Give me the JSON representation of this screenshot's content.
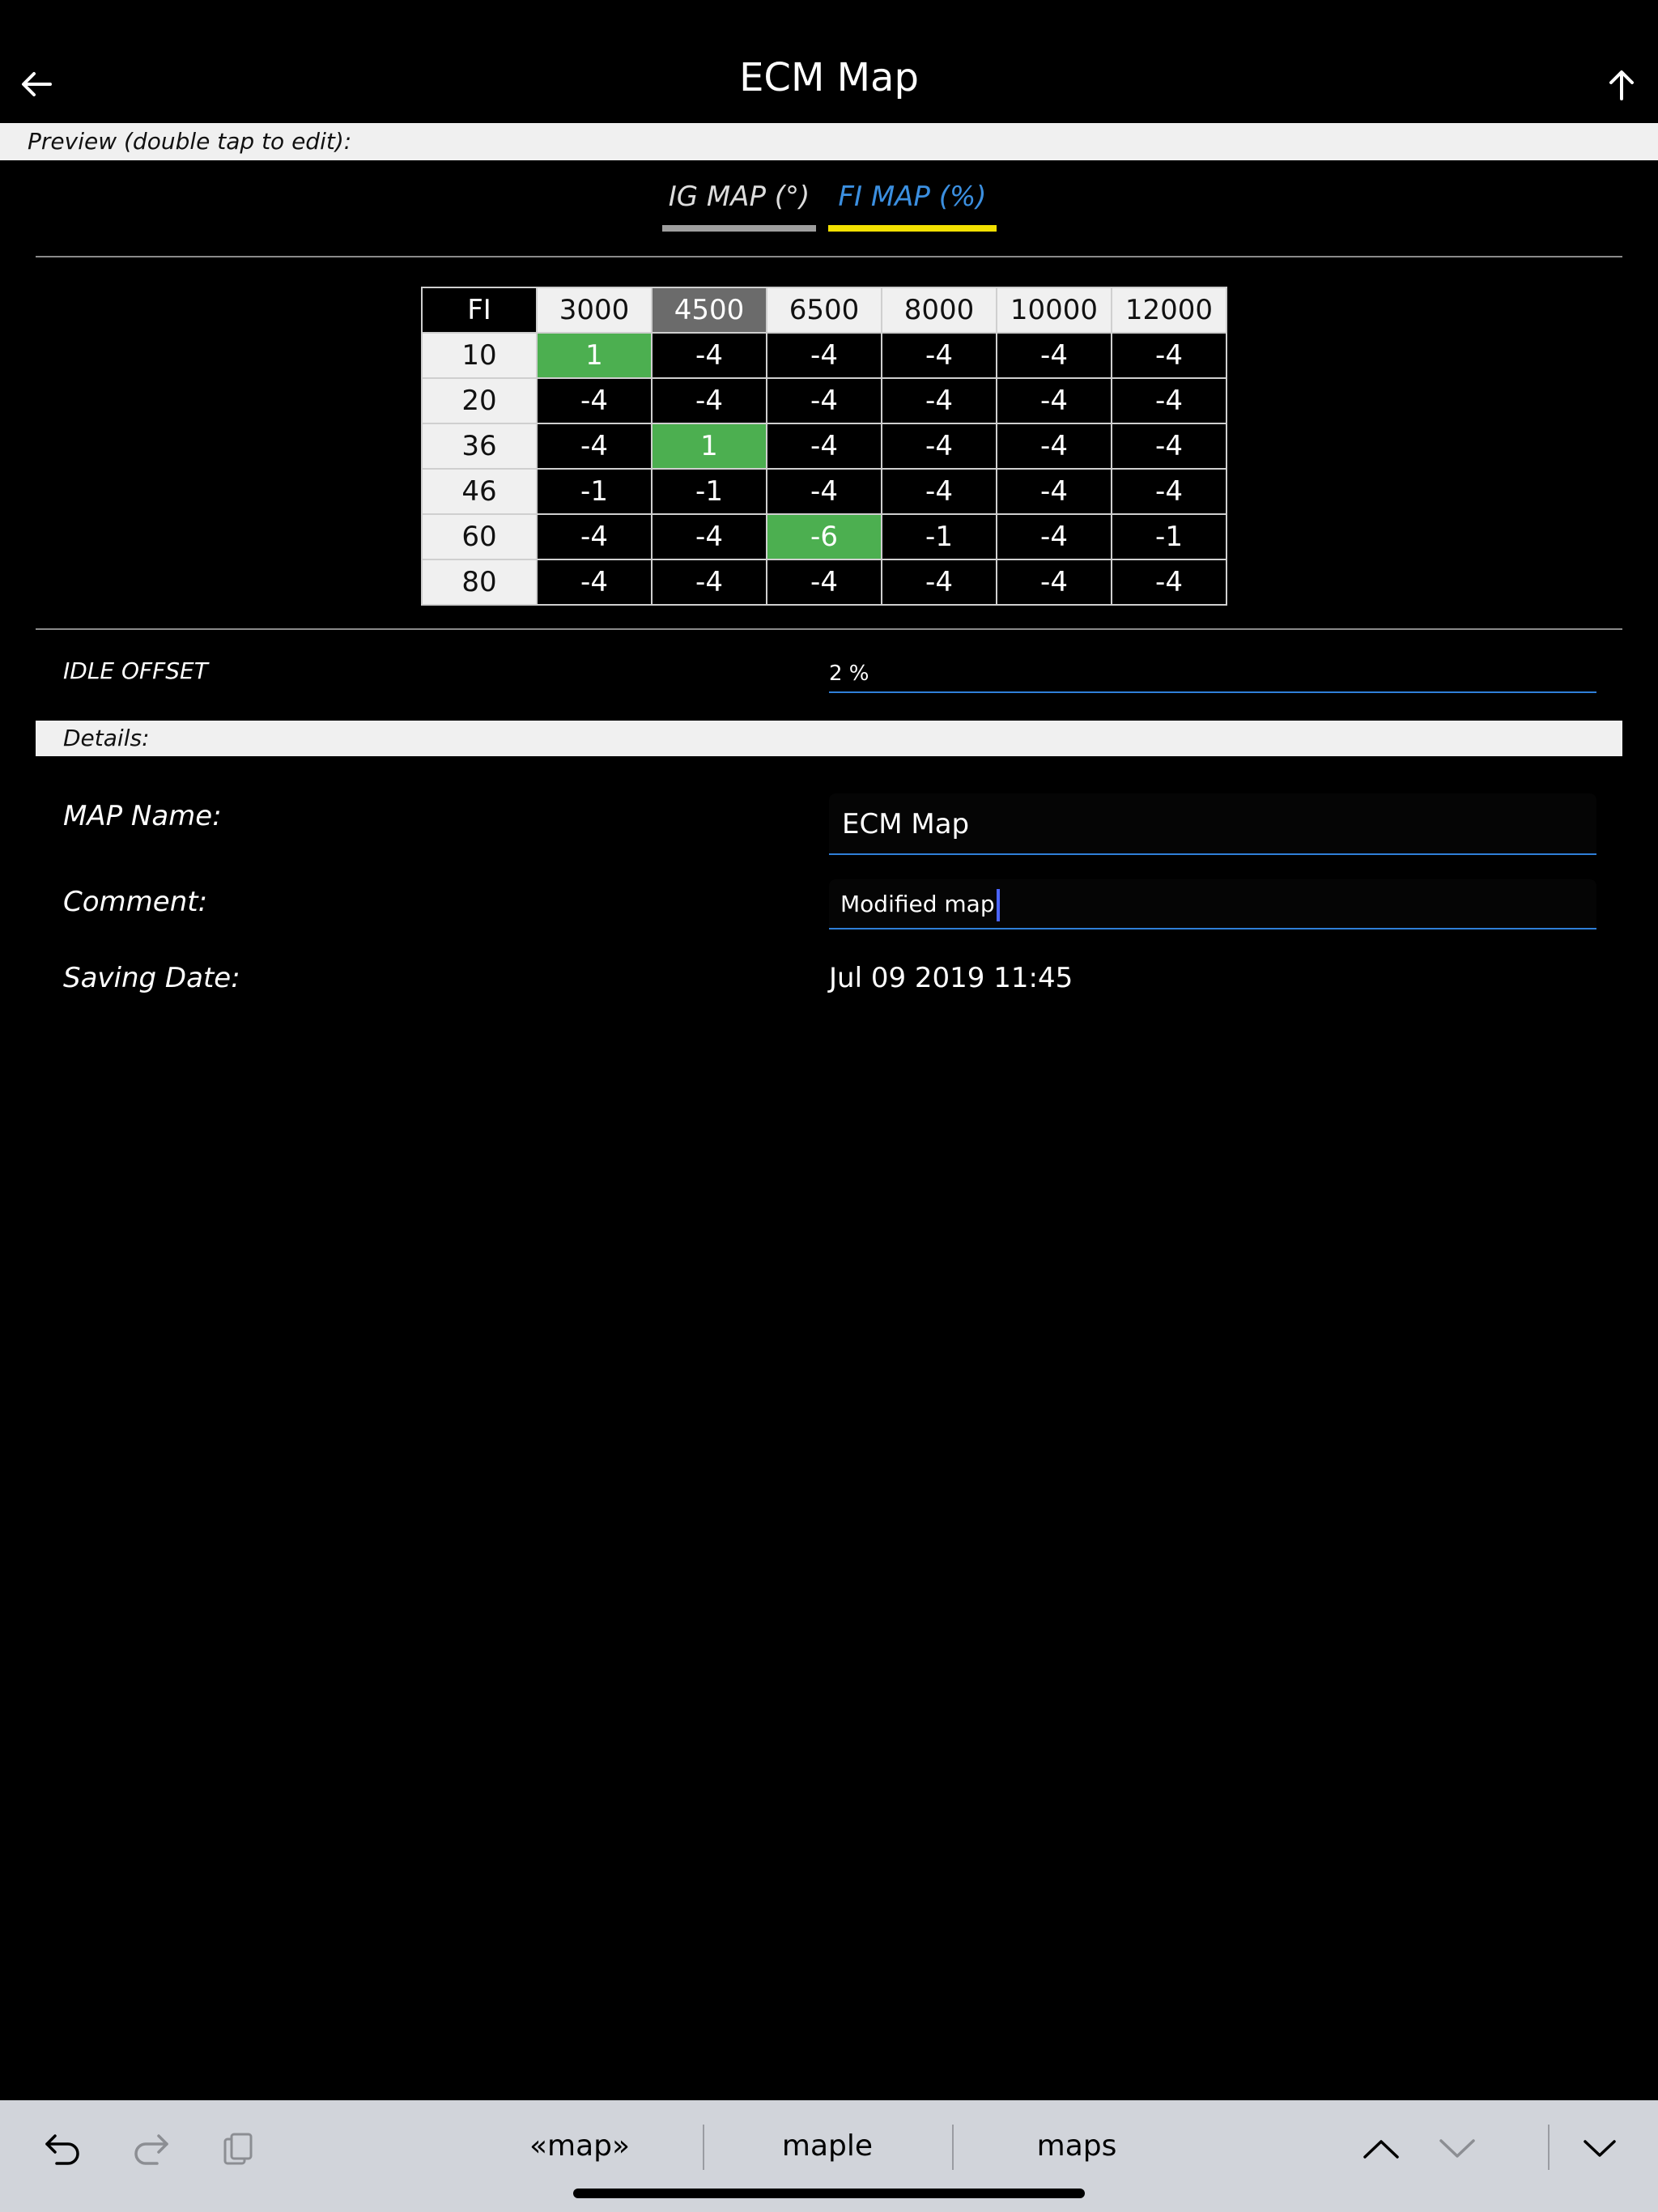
{
  "header": {
    "title": "ECM Map"
  },
  "preview_label": "Preview (double tap to edit):",
  "tabs": [
    {
      "label": "IG MAP (°)",
      "active": false
    },
    {
      "label": "FI MAP (%)",
      "active": true
    }
  ],
  "map_table": {
    "corner": "FI",
    "rpm_headers": [
      "3000",
      "4500",
      "6500",
      "8000",
      "10000",
      "12000"
    ],
    "selected_rpm_index": 1,
    "rows": [
      {
        "label": "10",
        "values": [
          "1",
          "-4",
          "-4",
          "-4",
          "-4",
          "-4"
        ]
      },
      {
        "label": "20",
        "values": [
          "-4",
          "-4",
          "-4",
          "-4",
          "-4",
          "-4"
        ]
      },
      {
        "label": "36",
        "values": [
          "-4",
          "1",
          "-4",
          "-4",
          "-4",
          "-4"
        ]
      },
      {
        "label": "46",
        "values": [
          "-1",
          "-1",
          "-4",
          "-4",
          "-4",
          "-4"
        ]
      },
      {
        "label": "60",
        "values": [
          "-4",
          "-4",
          "-6",
          "-1",
          "-4",
          "-1"
        ]
      },
      {
        "label": "80",
        "values": [
          "-4",
          "-4",
          "-4",
          "-4",
          "-4",
          "-4"
        ]
      }
    ],
    "highlighted_cells": [
      [
        0,
        0
      ],
      [
        2,
        1
      ],
      [
        4,
        2
      ]
    ],
    "highlight_color": "#4caf50"
  },
  "idle_offset": {
    "label": "IDLE OFFSET",
    "value": "2 %"
  },
  "details_label": "Details:",
  "details": {
    "map_name_label": "MAP Name:",
    "map_name_value": "ECM Map",
    "comment_label": "Comment:",
    "comment_value": "Modified map",
    "saving_date_label": "Saving Date:",
    "saving_date_value": "Jul 09 2019 11:45"
  },
  "keyboard_bar": {
    "suggestions": [
      "«map»",
      "maple",
      "maps"
    ],
    "icons": [
      "undo-icon",
      "redo-icon",
      "paste-icon",
      "chevron-up-icon",
      "chevron-down-icon",
      "dismiss-keyboard-icon"
    ]
  },
  "colors": {
    "accent_blue": "#3b8fe0",
    "tab_underline_active": "#f2e000",
    "field_underline": "#2f7fd8"
  }
}
